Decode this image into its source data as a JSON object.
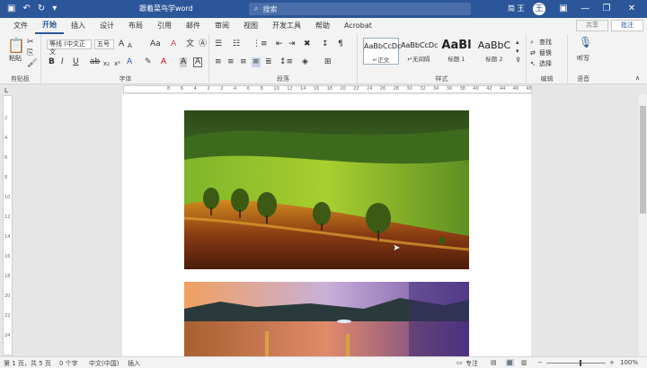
{
  "title_bar": {
    "document_title": "跟着菜鸟学word",
    "search_placeholder": "搜索",
    "user_name": "简 王",
    "avatar_letter": "王"
  },
  "tabs": [
    "文件",
    "开始",
    "插入",
    "设计",
    "布局",
    "引用",
    "邮件",
    "审阅",
    "视图",
    "开发工具",
    "帮助",
    "Acrobat"
  ],
  "active_tab": "开始",
  "share_label": "共享",
  "comment_label": "批注",
  "ribbon": {
    "clipboard": {
      "paste": "粘贴",
      "group": "剪贴板"
    },
    "font": {
      "font_name": "等线 (中文正文",
      "font_size": "五号",
      "group": "字体",
      "grow": "A",
      "shrink": "A",
      "case": "Aa",
      "clear": "A"
    },
    "paragraph": {
      "group": "段落"
    },
    "styles": {
      "items": [
        {
          "preview": "AaBbCcDc",
          "name": "↵正文"
        },
        {
          "preview": "AaBbCcDc",
          "name": "↵无间隔"
        },
        {
          "preview": "AaBl",
          "name": "标题 1"
        },
        {
          "preview": "AaBbC",
          "name": "标题 2"
        }
      ],
      "group": "样式"
    },
    "editing": {
      "find": "查找",
      "replace": "替换",
      "select": "选择",
      "group": "编辑"
    },
    "voice": {
      "dictate": "听写",
      "group": "语音"
    }
  },
  "status": {
    "page": "第 1 页，共 5 页",
    "words": "0 个字",
    "language": "中文(中国)",
    "insert_mode": "插入",
    "focus": "专注",
    "zoom": "100%"
  },
  "ruler_numbers": [
    "8",
    "6",
    "4",
    "2",
    "2",
    "4",
    "6",
    "8",
    "10",
    "12",
    "14",
    "16",
    "18",
    "20",
    "22",
    "24",
    "26",
    "28",
    "30",
    "32",
    "34",
    "36",
    "38",
    "40",
    "42",
    "44",
    "46",
    "48"
  ],
  "vruler_numbers": [
    "2",
    "4",
    "6",
    "8",
    "10",
    "12",
    "14",
    "16",
    "18",
    "20",
    "22",
    "24"
  ],
  "colors": {
    "word_blue": "#2b579a"
  }
}
